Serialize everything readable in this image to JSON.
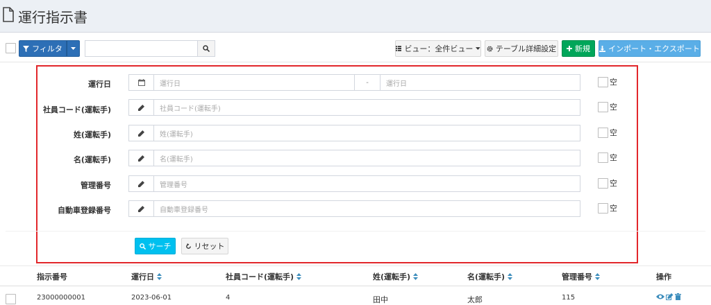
{
  "header": {
    "title": "運行指示書"
  },
  "toolbar": {
    "filter_label": "フィルタ",
    "search_value": "",
    "view_label": "ビュー：全件ビュー",
    "table_settings_label": "テーブル詳細設定",
    "new_label": "新規",
    "import_export_label": "インポート・エクスポート"
  },
  "filters": {
    "rows": [
      {
        "label": "運行日",
        "placeholder_from": "運行日",
        "dash": "-",
        "placeholder_to": "運行日",
        "empty_label": "空"
      },
      {
        "label": "社員コード(運転手)",
        "placeholder": "社員コード(運転手)",
        "empty_label": "空"
      },
      {
        "label": "姓(運転手)",
        "placeholder": "姓(運転手)",
        "empty_label": "空"
      },
      {
        "label": "名(運転手)",
        "placeholder": "名(運転手)",
        "empty_label": "空"
      },
      {
        "label": "管理番号",
        "placeholder": "管理番号",
        "empty_label": "空"
      },
      {
        "label": "自動車登録番号",
        "placeholder": "自動車登録番号",
        "empty_label": "空"
      }
    ],
    "search_label": "サーチ",
    "reset_label": "リセット"
  },
  "table": {
    "columns": [
      "指示番号",
      "運行日",
      "社員コード(運転手)",
      "姓(運転手)",
      "名(運転手)",
      "管理番号",
      "操作"
    ],
    "rows": [
      {
        "id": "23000000001",
        "date": "2023-06-01",
        "emp_code": "4",
        "last_name": "田中",
        "first_name": "太郎",
        "mgmt_no": "115"
      }
    ]
  },
  "colors": {
    "primary": "#2d6fb6",
    "success": "#00a65a",
    "info": "#5aaee7",
    "search": "#00c0ef",
    "highlight_border": "#e2262a"
  },
  "icons": [
    "document-icon",
    "funnel-icon",
    "caret-down-icon",
    "search-icon",
    "list-icon",
    "gear-icon",
    "plus-icon",
    "download-icon",
    "calendar-icon",
    "pencil-icon",
    "refresh-icon",
    "sort-icon",
    "eye-icon",
    "edit-icon",
    "trash-icon"
  ]
}
